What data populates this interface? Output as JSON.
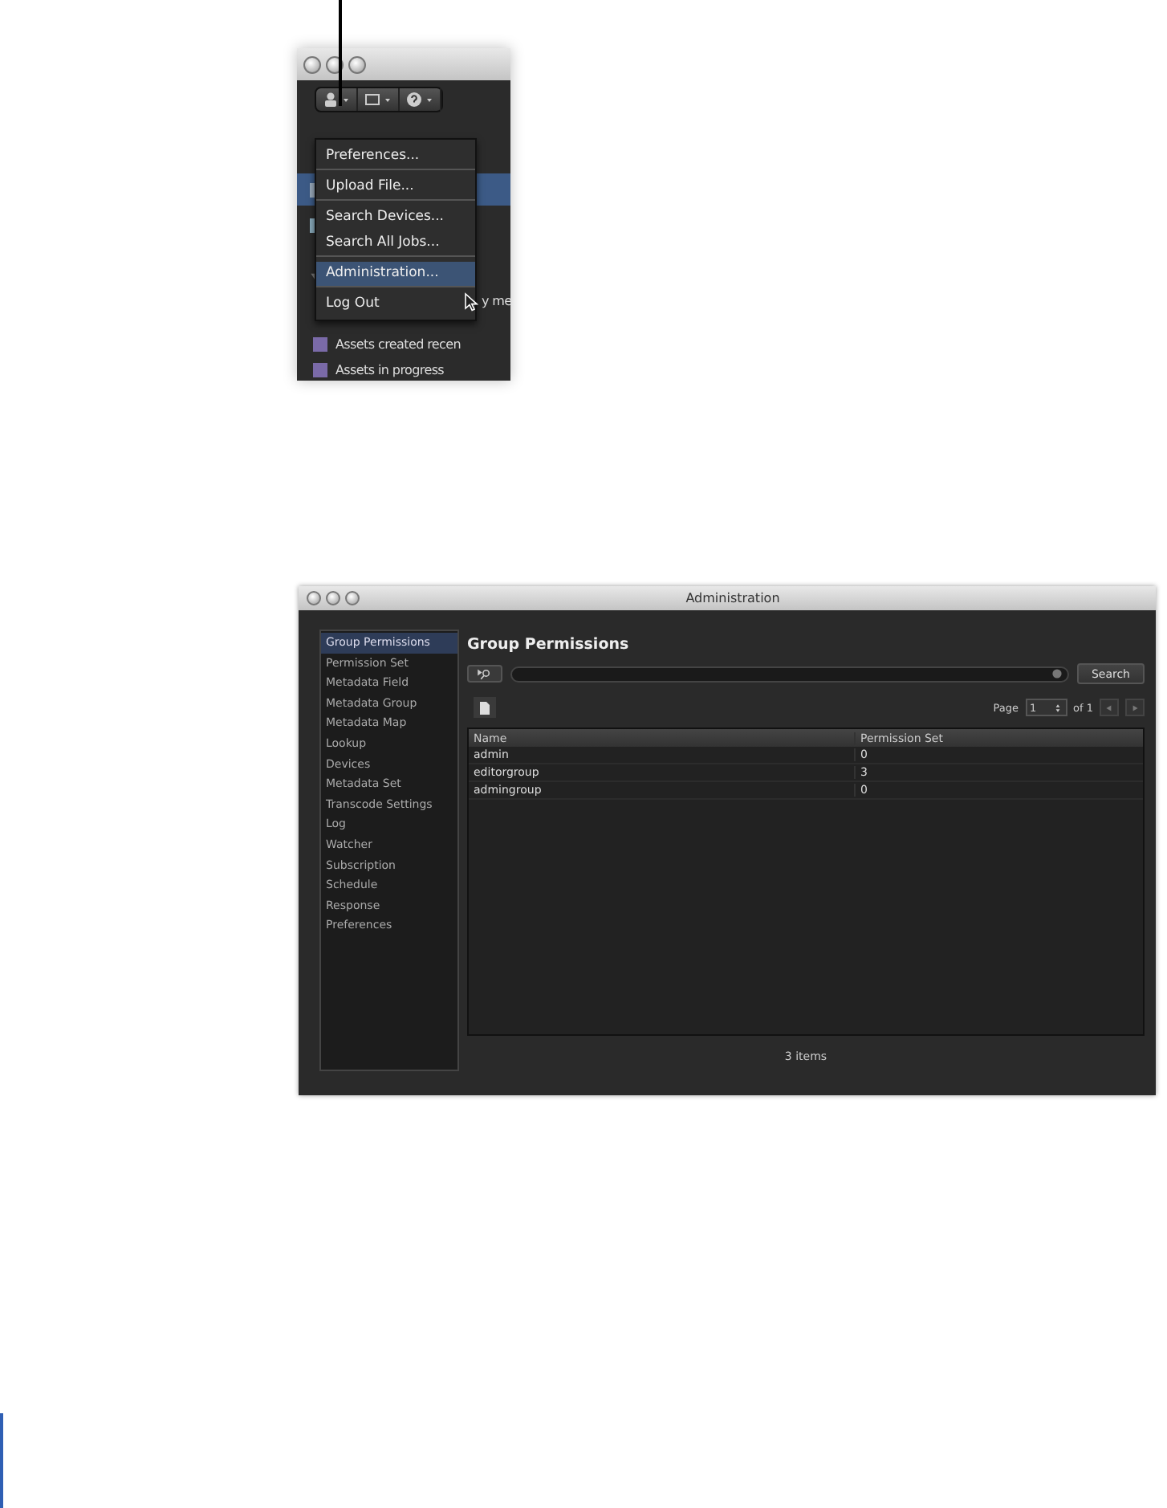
{
  "menu_window": {
    "background_items": [
      {
        "label": "y me"
      },
      {
        "label": "Assets created recen"
      },
      {
        "label": "Assets in progress"
      }
    ],
    "menu": {
      "items": [
        {
          "label": "Preferences...",
          "selected": false,
          "divider_above": false
        },
        {
          "label": "Upload File...",
          "selected": false,
          "divider_above": true
        },
        {
          "label": "Search Devices...",
          "selected": false,
          "divider_above": true
        },
        {
          "label": "Search All Jobs...",
          "selected": false,
          "divider_above": false
        },
        {
          "label": "Administration...",
          "selected": true,
          "divider_above": true
        },
        {
          "label": "Log Out",
          "selected": false,
          "divider_above": true
        }
      ]
    }
  },
  "admin_window": {
    "title": "Administration",
    "sidebar": {
      "items": [
        {
          "label": "Group Permissions",
          "selected": true
        },
        {
          "label": "Permission Set",
          "selected": false
        },
        {
          "label": "Metadata Field",
          "selected": false
        },
        {
          "label": "Metadata Group",
          "selected": false
        },
        {
          "label": "Metadata Map",
          "selected": false
        },
        {
          "label": "Lookup",
          "selected": false
        },
        {
          "label": "Devices",
          "selected": false
        },
        {
          "label": "Metadata Set",
          "selected": false
        },
        {
          "label": "Transcode Settings",
          "selected": false
        },
        {
          "label": "Log",
          "selected": false
        },
        {
          "label": "Watcher",
          "selected": false
        },
        {
          "label": "Subscription",
          "selected": false
        },
        {
          "label": "Schedule",
          "selected": false
        },
        {
          "label": "Response",
          "selected": false
        },
        {
          "label": "Preferences",
          "selected": false
        }
      ]
    },
    "heading": "Group Permissions",
    "search_button": "Search",
    "pager": {
      "label": "Page",
      "value": "1",
      "of": "of 1"
    },
    "table": {
      "columns": [
        "Name",
        "Permission Set"
      ],
      "rows": [
        [
          "admin",
          "0"
        ],
        [
          "editorgroup",
          "3"
        ],
        [
          "admingroup",
          "0"
        ]
      ]
    },
    "footer": "3 items"
  }
}
